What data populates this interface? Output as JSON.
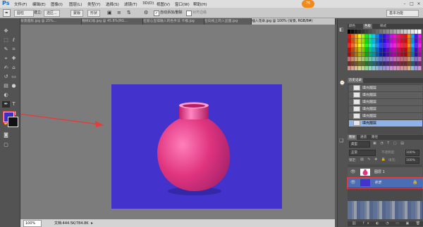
{
  "app": {
    "logo": "Ps"
  },
  "menu": {
    "items": [
      "文件(F)",
      "编辑(E)",
      "图像(I)",
      "图层(L)",
      "类型(Y)",
      "选择(S)",
      "滤镜(T)",
      "3D(D)",
      "视图(V)",
      "窗口(W)",
      "帮助(H)"
    ],
    "badge": "76",
    "workspace": "基本功能"
  },
  "options": {
    "shape": "圆柱",
    "mode": "建立:",
    "btn1": "选区...",
    "btn2": "蒙版",
    "btn3": "形状",
    "auto_add": "自动添加/删除",
    "align": "对齐边缘"
  },
  "tabs": [
    "背景圆形.jpg @ 25%...",
    "锦绣幻境.jpg @ 45.8%(RG...",
    "在窗心显得融入的色手法 卡榴.jpg",
    "在向视上的入显图.jpg",
    "插入花朵.jpg @ 100% (背景, RGB/8#)"
  ],
  "status": {
    "zoom": "100%",
    "doc": "文档:444.5K/784.8K"
  },
  "colors": {
    "canvas": "#4333cc",
    "foreground": "#3d2fc3",
    "vase_main": "#e0347f",
    "vase_light": "#ff7fbb",
    "arrow": "#e63b3b",
    "history_selected": "#8fb3e8"
  },
  "panels": {
    "swatch_tabs": [
      "颜色",
      "色板",
      "样式"
    ],
    "history_tab": "历史记录",
    "history": [
      "填充图层",
      "填充图层",
      "填充图层",
      "填充图层",
      "填充图层",
      "填充图层"
    ],
    "layers_tabs": [
      "图层",
      "通道",
      "路径"
    ],
    "filter": "类型",
    "blend": "正常",
    "opacity_label": "不透明度:",
    "opacity": "100%",
    "lock_label": "锁定:",
    "fill_label": "填充:",
    "fill": "100%",
    "layers": [
      {
        "name": "图层 1"
      },
      {
        "name": "背景"
      }
    ]
  }
}
